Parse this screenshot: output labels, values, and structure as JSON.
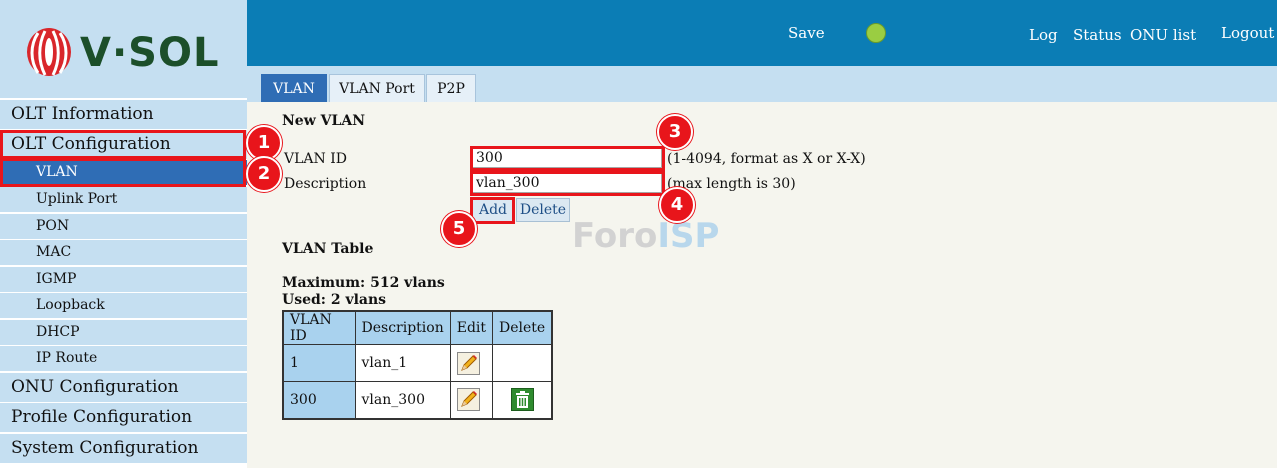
{
  "brand": {
    "name": "V·SOL",
    "colors": {
      "logo_red": "#d9262b",
      "logo_green": "#1c4f2a"
    }
  },
  "header": {
    "save_label": "Save",
    "status_color": "#9acd42",
    "links": {
      "log": "Log",
      "status": "Status",
      "onu_list": "ONU list",
      "logout": "Logout"
    }
  },
  "sidebar": {
    "olt_information": "OLT Information",
    "olt_configuration": "OLT Configuration",
    "sub_items": [
      "VLAN",
      "Uplink Port",
      "PON",
      "MAC",
      "IGMP",
      "Loopback",
      "DHCP",
      "IP Route"
    ],
    "active_sub_item": "VLAN",
    "onu_configuration": "ONU Configuration",
    "profile_configuration": "Profile Configuration",
    "system_configuration": "System Configuration"
  },
  "tabs": [
    {
      "label": "VLAN",
      "active": true
    },
    {
      "label": "VLAN Port",
      "active": false
    },
    {
      "label": "P2P",
      "active": false
    }
  ],
  "new_vlan": {
    "heading": "New VLAN",
    "vlan_id_label": "VLAN ID",
    "vlan_id_value": "300",
    "vlan_id_hint": "(1-4094, format as X or X-X)",
    "description_label": "Description",
    "description_value": "vlan_300",
    "description_hint": "(max length is 30)",
    "add_label": "Add",
    "delete_label": "Delete"
  },
  "watermark": {
    "part1": "Foro",
    "part2": "ISP"
  },
  "vlan_table": {
    "heading": "VLAN Table",
    "maximum": "Maximum: 512 vlans",
    "used": "Used: 2 vlans",
    "columns": [
      "VLAN ID",
      "Description",
      "Edit",
      "Delete"
    ],
    "rows": [
      {
        "id": "1",
        "description": "vlan_1",
        "editable": true,
        "deletable": false
      },
      {
        "id": "300",
        "description": "vlan_300",
        "editable": true,
        "deletable": true
      }
    ]
  },
  "annotations": {
    "color": "#e8151b",
    "badges": [
      "1",
      "2",
      "3",
      "4",
      "5"
    ]
  }
}
